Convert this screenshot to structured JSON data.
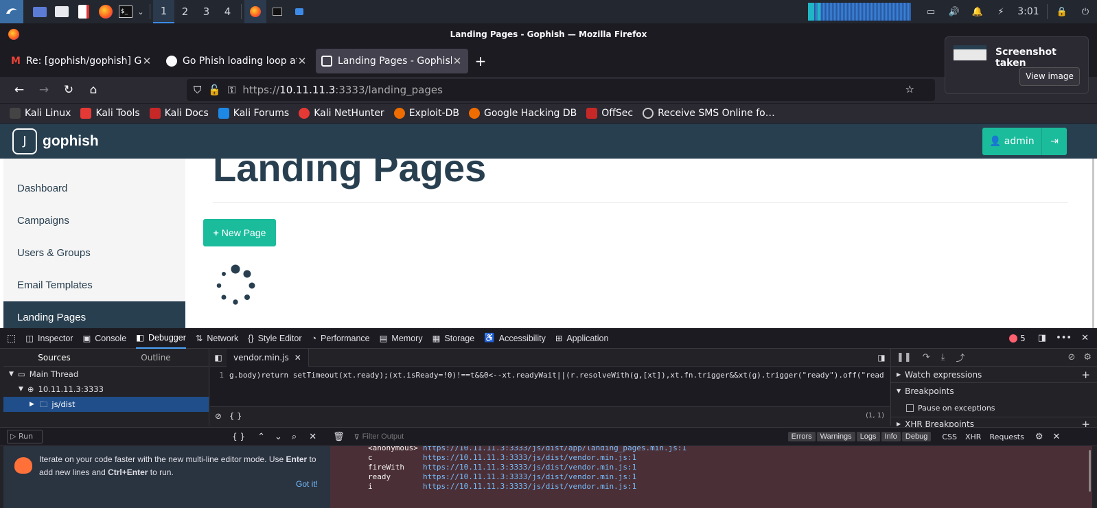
{
  "taskbar": {
    "workspaces": [
      "1",
      "2",
      "3",
      "4"
    ],
    "clock": "3:01"
  },
  "window": {
    "title": "Landing Pages - Gophish — Mozilla Firefox"
  },
  "tabs": [
    {
      "label": "Re: [gophish/gophish] Go"
    },
    {
      "label": "Go Phish loading loop at l"
    },
    {
      "label": "Landing Pages - Gophish"
    }
  ],
  "urlbar": {
    "url_prefix": "https://",
    "url_host": "10.11.11.3",
    "url_rest": ":3333/landing_pages"
  },
  "bookmarks": [
    {
      "label": "Kali Linux",
      "color": "#1a1a1a"
    },
    {
      "label": "Kali Tools",
      "color": "#e53935"
    },
    {
      "label": "Kali Docs",
      "color": "#c62828"
    },
    {
      "label": "Kali Forums",
      "color": "#1e88e5"
    },
    {
      "label": "Kali NetHunter",
      "color": "#e53935"
    },
    {
      "label": "Exploit-DB",
      "color": "#ef6c00"
    },
    {
      "label": "Google Hacking DB",
      "color": "#ef6c00"
    },
    {
      "label": "OffSec",
      "color": "#c62828"
    },
    {
      "label": "Receive SMS Online fo…",
      "color": "#cccccc"
    }
  ],
  "notification": {
    "title": "Screenshot taken",
    "button": "View image"
  },
  "gophish": {
    "brand": "gophish",
    "user_button": "admin",
    "page_title": "Landing Pages",
    "new_page_button": "New Page",
    "sidebar": [
      "Dashboard",
      "Campaigns",
      "Users & Groups",
      "Email Templates",
      "Landing Pages"
    ],
    "colors": {
      "navbar": "#283f50",
      "accent": "#1abc9c"
    }
  },
  "devtools": {
    "tabs": [
      "Inspector",
      "Console",
      "Debugger",
      "Network",
      "Style Editor",
      "Performance",
      "Memory",
      "Storage",
      "Accessibility",
      "Application"
    ],
    "error_count": "5",
    "sources_tab": "Sources",
    "outline_tab": "Outline",
    "tree": {
      "thread": "Main Thread",
      "host": "10.11.11.3:3333",
      "folder": "js/dist"
    },
    "file_tab": "vendor.min.js",
    "code_line_number": "1",
    "code": "g.body)return setTimeout(xt.ready);(xt.isReady=!0)!==t&&0<--xt.readyWait||(r.resolveWith(g,[xt]),xt.fn.trigger&&xt(g).trigger(\"ready\").off(\"read",
    "cursor_pos": "(1, 1)",
    "braces": "{ }",
    "right_panel": {
      "watch": "Watch expressions",
      "breakpoints": "Breakpoints",
      "pause": "Pause on exceptions",
      "xhr": "XHR Breakpoints"
    },
    "console": {
      "run": "Run",
      "filter_placeholder": "Filter Output",
      "filters": [
        "Errors",
        "Warnings",
        "Logs",
        "Info",
        "Debug"
      ],
      "extra_filters": [
        "CSS",
        "XHR",
        "Requests"
      ],
      "hint_text_1": "Iterate on your code faster with the new multi-line editor mode. Use ",
      "hint_bold_1": "Enter",
      "hint_text_2": " to add new lines and ",
      "hint_bold_2": "Ctrl+Enter",
      "hint_text_3": " to run.",
      "got_it": "Got it!",
      "stack": [
        {
          "fn": "<anonymous>",
          "loc": "https://10.11.11.3:3333/js/dist/app/landing_pages.min.js:1"
        },
        {
          "fn": "c",
          "loc": "https://10.11.11.3:3333/js/dist/vendor.min.js:1"
        },
        {
          "fn": "fireWith",
          "loc": "https://10.11.11.3:3333/js/dist/vendor.min.js:1"
        },
        {
          "fn": "ready",
          "loc": "https://10.11.11.3:3333/js/dist/vendor.min.js:1"
        },
        {
          "fn": "i",
          "loc": "https://10.11.11.3:3333/js/dist/vendor.min.js:1"
        }
      ]
    }
  }
}
